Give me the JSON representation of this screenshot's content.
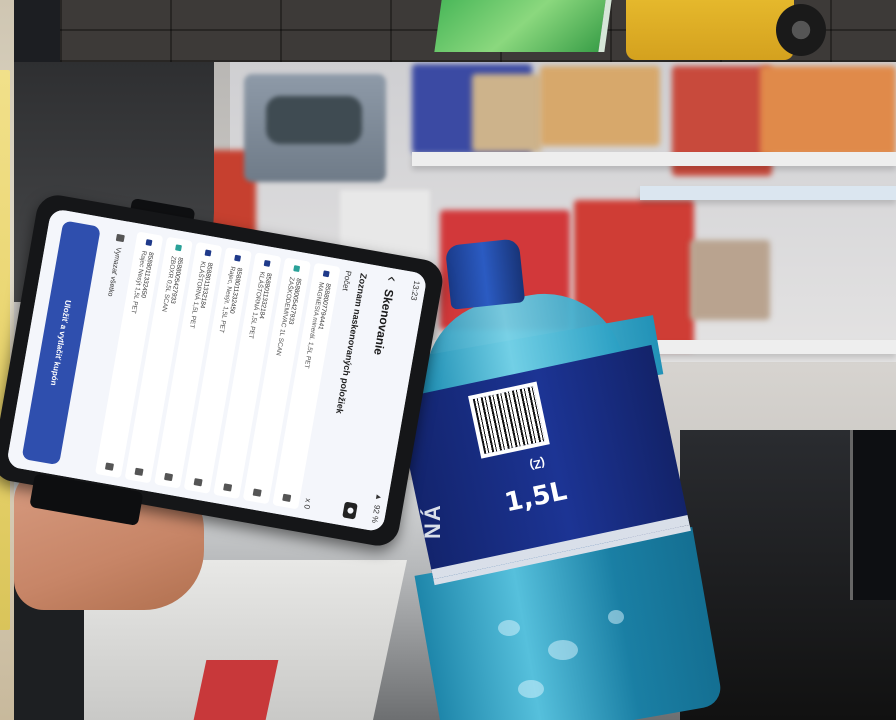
{
  "phone_app": {
    "status": {
      "time": "13:23",
      "battery": "92 %"
    },
    "header": {
      "title": "Skenovanie",
      "back_icon": "arrow-left-icon",
      "camera_icon": "camera-icon"
    },
    "section_title": "Zoznam naskenovaných položiek",
    "count_label": "Počet",
    "count_value": "x 0",
    "items": [
      {
        "code": "8588007794441",
        "name": "MAGNESIA minerál. 1,5L PET",
        "color": "blue"
      },
      {
        "code": "8588005427933",
        "name": "ZAŠKODEMIVAC 1L SCAN",
        "color": "teal"
      },
      {
        "code": "8588011332184",
        "name": "KLÁŠTORNÁ 1,5L PET",
        "color": "blue"
      },
      {
        "code": "8588011332450",
        "name": "Rajec, Nesýt. 1,5L PET",
        "color": "blue"
      },
      {
        "code": "8588011332184",
        "name": "KLÁŠTORNÁ 1,5L PET",
        "color": "blue"
      },
      {
        "code": "8588005427933",
        "name": "ZBOXR 0,5L SCAN",
        "color": "teal"
      },
      {
        "code": "8588011332450",
        "name": "Rajec Nesýt 1,5L PET",
        "color": "blue"
      }
    ],
    "clear_label": "Vymazať všetko",
    "save_button": "Uložiť a vytlačiť kupón"
  },
  "bottle": {
    "volume": "1,5L",
    "mark": "(Z)",
    "brand_fragment": "NÁ"
  },
  "colors": {
    "app_accent": "#2f4fae",
    "bottle_label": "#1c3494",
    "water": "#56c0dc"
  }
}
